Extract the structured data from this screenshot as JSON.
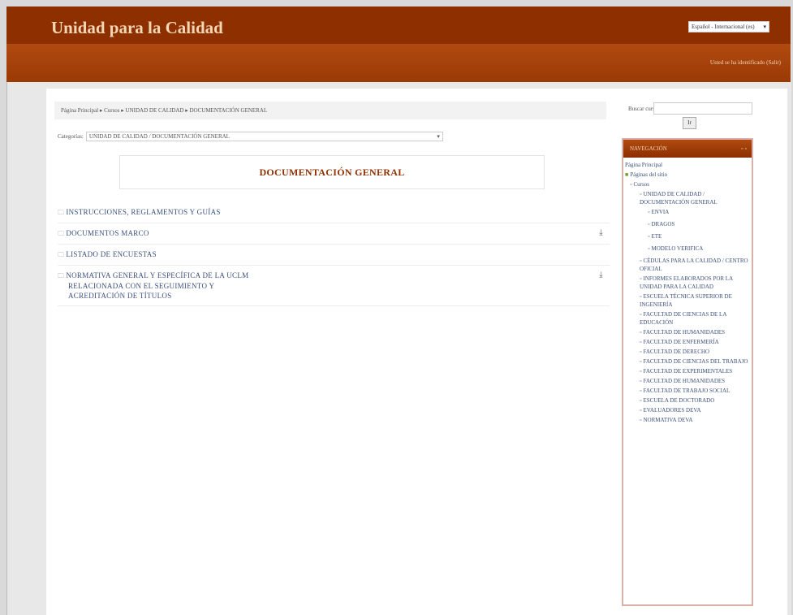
{
  "header": {
    "site_title": "Unidad para la Calidad",
    "language_select": "Español - Internacional (es)",
    "login_info": "Usted se ha identificado (Salir)"
  },
  "breadcrumb": "Página Principal ▸ Cursos ▸ UNIDAD DE CALIDAD ▸ DOCUMENTACIÓN GENERAL",
  "search": {
    "label": "Buscar cursos:",
    "button": "Ir"
  },
  "category": {
    "label": "Categorías:",
    "value": "UNIDAD DE CALIDAD / DOCUMENTACIÓN GENERAL"
  },
  "doc_title": "DOCUMENTACIÓN GENERAL",
  "folders": [
    {
      "lines": [
        "INSTRUCCIONES, REGLAMENTOS Y GUÍAS"
      ],
      "download": false
    },
    {
      "lines": [
        "DOCUMENTOS MARCO"
      ],
      "download": true
    },
    {
      "lines": [
        "LISTADO DE ENCUESTAS"
      ],
      "download": false
    },
    {
      "lines": [
        "NORMATIVA GENERAL Y ESPECÍFICA DE LA UCLM",
        "RELACIONADA CON EL SEGUIMIENTO Y",
        "ACREDITACIÓN DE TÍTULOS"
      ],
      "download": true
    }
  ],
  "icons": {
    "folder": "folder-icon",
    "download": "download-icon",
    "bullet": "bullet-icon",
    "dropdown": "chevron-down-icon"
  },
  "navigation": {
    "title": "NAVEGACIÓN",
    "controls": "▫▫",
    "items": [
      {
        "label": "Página Principal",
        "level": 0,
        "icon": ""
      },
      {
        "label": "Páginas del sitio",
        "level": 0,
        "icon": "site"
      },
      {
        "label": "Cursos",
        "level": 1,
        "icon": "bullet"
      },
      {
        "label": "UNIDAD DE CALIDAD / DOCUMENTACIÓN GENERAL",
        "level": 2,
        "icon": "bullet"
      },
      {
        "label": "ENVIA",
        "level": 3,
        "icon": "bullet"
      },
      {
        "label": "DRAGOS",
        "level": 3,
        "icon": "bullet"
      },
      {
        "label": "ETE",
        "level": 3,
        "icon": "bullet"
      },
      {
        "label": "MODELO VERIFICA",
        "level": 3,
        "icon": "bullet"
      },
      {
        "label": "CÉDULAS PARA LA CALIDAD / CENTRO OFICIAL",
        "level": 2,
        "icon": "bullet"
      },
      {
        "label": "INFORMES ELABORADOS POR LA UNIDAD PARA LA CALIDAD",
        "level": 2,
        "icon": "bullet"
      },
      {
        "label": "ESCUELA TÉCNICA SUPERIOR DE INGENIERÍA",
        "level": 2,
        "icon": "bullet"
      },
      {
        "label": "FACULTAD DE CIENCIAS DE LA EDUCACIÓN",
        "level": 2,
        "icon": "bullet"
      },
      {
        "label": "FACULTAD DE HUMANIDADES",
        "level": 2,
        "icon": "bullet"
      },
      {
        "label": "FACULTAD DE ENFERMERÍA",
        "level": 2,
        "icon": "bullet"
      },
      {
        "label": "FACULTAD DE DERECHO",
        "level": 2,
        "icon": "bullet"
      },
      {
        "label": "FACULTAD DE CIENCIAS DEL TRABAJO",
        "level": 2,
        "icon": "bullet"
      },
      {
        "label": "FACULTAD DE EXPERIMENTALES",
        "level": 2,
        "icon": "bullet"
      },
      {
        "label": "FACULTAD DE HUMANIDADES",
        "level": 2,
        "icon": "bullet"
      },
      {
        "label": "FACULTAD DE TRABAJO SOCIAL",
        "level": 2,
        "icon": "bullet"
      },
      {
        "label": "ESCUELA DE DOCTORADO",
        "level": 2,
        "icon": "bullet"
      },
      {
        "label": "EVALUADORES DEVA",
        "level": 2,
        "icon": "bullet"
      },
      {
        "label": "NORMATIVA DEVA",
        "level": 2,
        "icon": "bullet"
      }
    ]
  }
}
